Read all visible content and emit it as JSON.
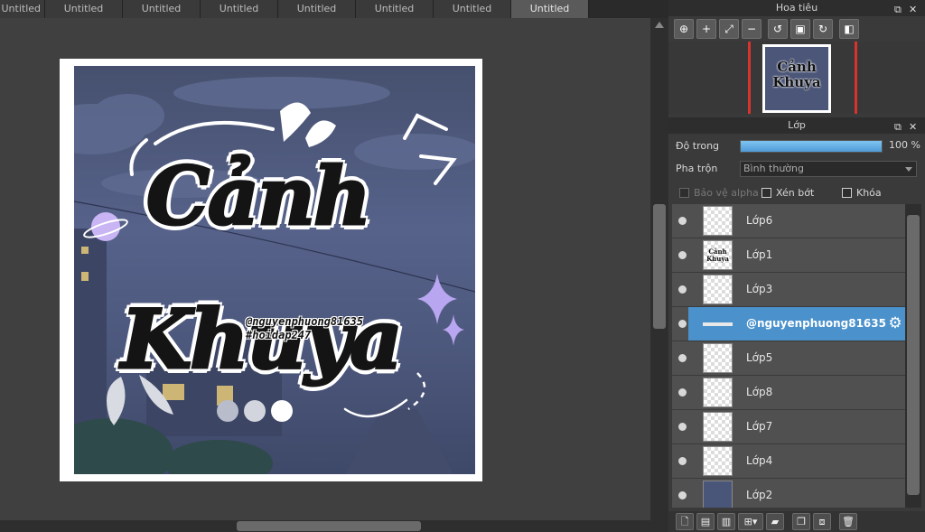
{
  "tabs": [
    {
      "label": "Untitled",
      "active": false
    },
    {
      "label": "Untitled",
      "active": false
    },
    {
      "label": "Untitled",
      "active": false
    },
    {
      "label": "Untitled",
      "active": false
    },
    {
      "label": "Untitled",
      "active": false
    },
    {
      "label": "Untitled",
      "active": false
    },
    {
      "label": "Untitled",
      "active": false
    },
    {
      "label": "Untitled",
      "active": true
    }
  ],
  "artwork": {
    "title_line1": "Cảnh",
    "title_line2": "Khuya",
    "watermark_line1": "@nguyenphuong81635",
    "watermark_line2": "#hoidap247"
  },
  "navigator": {
    "title": "Hoa tiêu",
    "thumb_text_line1": "Cảnh",
    "thumb_text_line2": "Khuya",
    "tools": [
      "zoom-icon",
      "zoom-in-icon",
      "fit-icon",
      "zoom-out-icon",
      "rotate-left-icon",
      "fit-screen-icon",
      "rotate-right-icon",
      "flip-icon"
    ]
  },
  "layer_panel": {
    "title": "Lớp",
    "opacity_label": "Độ trong",
    "opacity_value": 100,
    "opacity_text": "100 %",
    "blend_label": "Pha trộn",
    "blend_value": "Bình thường",
    "protect_alpha": "Bảo vệ alpha",
    "clipping": "Xén bớt",
    "lock": "Khóa"
  },
  "layers": [
    {
      "name": "Lớp6",
      "thumb": "empty",
      "selected": false
    },
    {
      "name": "Lớp1",
      "thumb": "text",
      "thumb_text": "Cảnh Khuya",
      "selected": false
    },
    {
      "name": "Lớp3",
      "thumb": "empty",
      "selected": false
    },
    {
      "name": "@nguyenphuong81635",
      "thumb": "strip",
      "selected": true
    },
    {
      "name": "Lớp5",
      "thumb": "empty",
      "selected": false
    },
    {
      "name": "Lớp8",
      "thumb": "empty",
      "selected": false
    },
    {
      "name": "Lớp7",
      "thumb": "empty",
      "selected": false
    },
    {
      "name": "Lớp4",
      "thumb": "empty",
      "selected": false
    },
    {
      "name": "Lớp2",
      "thumb": "photo",
      "selected": false
    }
  ],
  "colors": {
    "accent": "#4b92cc",
    "guide_red": "#d8332c",
    "sparkle": "#b9a6f0"
  }
}
